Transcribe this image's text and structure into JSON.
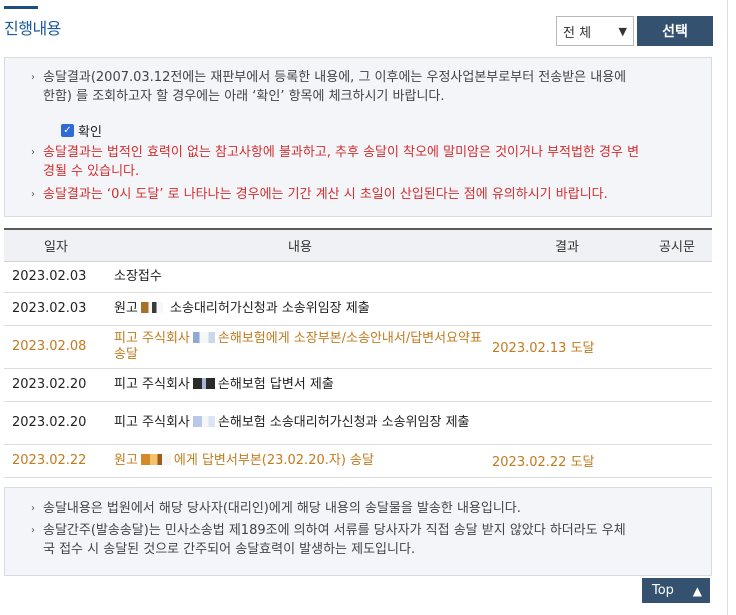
{
  "header": {
    "title": "진행내용",
    "filter_value": "전 체",
    "select_button": "선택"
  },
  "notice_top": {
    "line1": "송달결과(2007.03.12전에는 재판부에서 등록한 내용에, 그 이후에는 우정사업본부로부터 전송받은 내용에",
    "line1b": "한함) 를 조회하고자 할 경우에는 아래 ‘확인’ 항목에 체크하시기 바랍니다.",
    "confirm_label": "확인",
    "line2": "송달결과는 법적인 효력이 없는 참고사항에 불과하고, 추후 송달이 착오에 말미암은 것이거나 부적법한 경우 변",
    "line2b": "경될 수 있습니다.",
    "line3": "송달결과는 ‘0시 도달’ 로 나타나는 경우에는 기간 계산 시 초일이 산입된다는 점에 유의하시기 바랍니다."
  },
  "table": {
    "headers": [
      "일자",
      "내용",
      "결과",
      "공시문"
    ],
    "rows": [
      {
        "date": "2023.02.03",
        "content_a": "소장접수",
        "content_b": "",
        "result": "",
        "highlight": false
      },
      {
        "date": "2023.02.03",
        "content_a": "원고",
        "content_b": " 소송대리허가신청과 소송위임장 제출",
        "result": "",
        "highlight": false
      },
      {
        "date": "2023.02.08",
        "content_a": "피고 주식회사",
        "content_b": "손해보험에게 소장부본/소송안내서/답변서요약표 송달",
        "result": "2023.02.13 도달",
        "highlight": true
      },
      {
        "date": "2023.02.20",
        "content_a": "피고 주식회사",
        "content_b": "손해보험 답변서 제출",
        "result": "",
        "highlight": false
      },
      {
        "date": "2023.02.20",
        "content_a": "피고 주식회사",
        "content_b": "손해보험 소송대리허가신청과 소송위임장 제출",
        "result": "",
        "highlight": false
      },
      {
        "date": "2023.02.22",
        "content_a": "원고",
        "content_b": "에게 답변서부본(23.02.20.자) 송달",
        "result": "2023.02.22 도달",
        "highlight": true
      }
    ]
  },
  "notice_bottom": {
    "line1": "송달내용은 법원에서 해당 당사자(대리인)에게 해당 내용의 송달물을 발송한 내용입니다.",
    "line2": "송달간주(발송송달)는 민사소송법 제189조에 의하여 서류를 당사자가 직접 송달 받지 않았다 하더라도 우체",
    "line2b": "국 접수 시 송달된 것으로 간주되어 송달효력이 발생하는 제도입니다."
  },
  "footer": {
    "top_label": "Top"
  },
  "colors": {
    "accent": "#34516f",
    "title": "#1d5aa0",
    "warning": "#d32f2f",
    "highlight_row": "#c27a1d"
  }
}
